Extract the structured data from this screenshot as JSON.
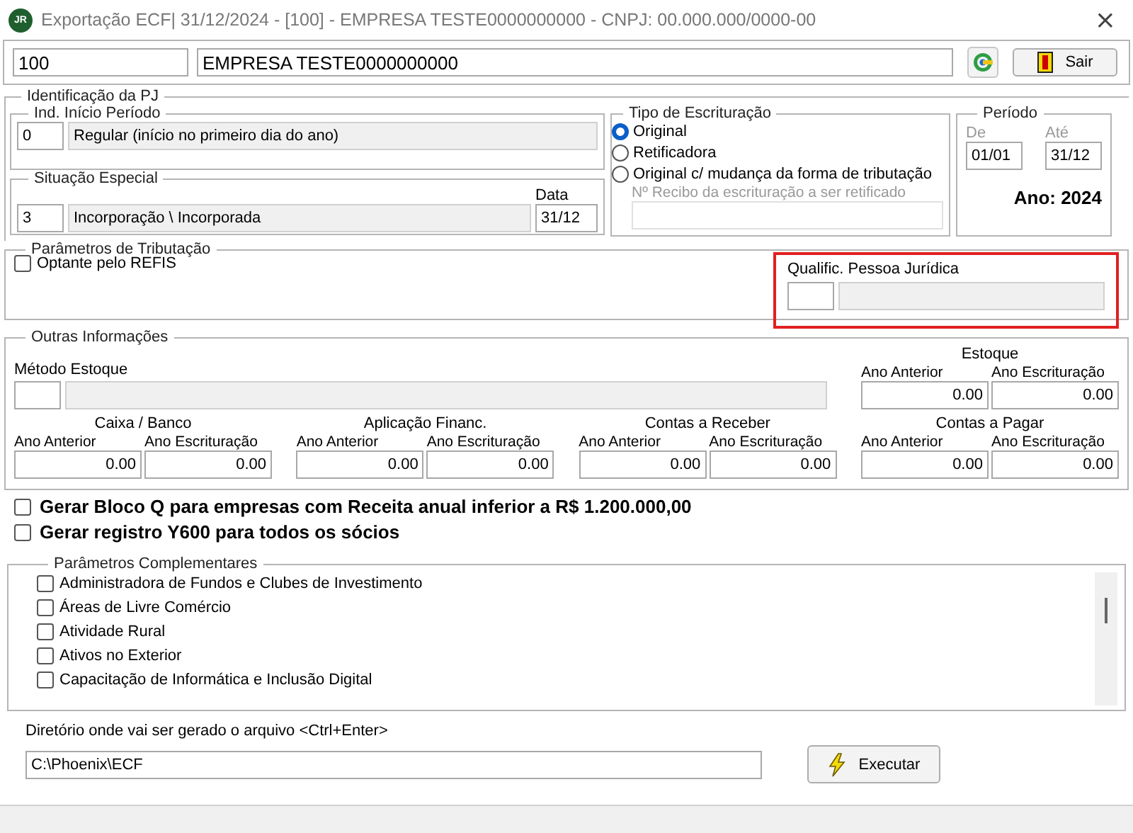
{
  "window": {
    "logo": "JR",
    "title": "Exportação ECF|  31/12/2024 - [100] - EMPRESA TESTE0000000000 - CNPJ: 00.000.000/0000-00",
    "close": "×"
  },
  "header": {
    "code": "100",
    "company": "EMPRESA TESTE0000000000",
    "exit_button": "Sair"
  },
  "identificacao": {
    "title": "Identificação da PJ",
    "inicio_periodo": {
      "title": "Ind. Início Período",
      "code": "0",
      "description": "Regular (início no primeiro dia do ano)"
    },
    "situacao_especial": {
      "title": "Situação Especial",
      "code": "3",
      "description": "Incorporação \\ Incorporada",
      "date_label": "Data",
      "date": "31/12"
    },
    "tipo_escrituracao": {
      "title": "Tipo de Escrituração",
      "options": [
        {
          "label": "Original",
          "selected": true
        },
        {
          "label": "Retificadora",
          "selected": false
        },
        {
          "label": "Original c/ mudança da forma de tributação",
          "selected": false
        }
      ],
      "recibo_label": "Nº Recibo da escrituração a ser retificado",
      "recibo_disabled": true
    },
    "periodo": {
      "title": "Período",
      "from_label": "De",
      "from": "01/01",
      "to_label": "Até",
      "to": "31/12",
      "year": "Ano: 2024"
    }
  },
  "tributacao": {
    "title": "Parâmetros de Tributação",
    "refis": {
      "label": "Optante pelo REFIS",
      "checked": false
    },
    "qualificacao_label": "Qualific. Pessoa Jurídica",
    "highlighted": true
  },
  "outras": {
    "title": "Outras Informações",
    "metodo_label": "Método Estoque",
    "estoque": {
      "title": "Estoque",
      "columns": [
        "Ano Anterior",
        "Ano Escrituração"
      ],
      "values": [
        "0.00",
        "0.00"
      ]
    },
    "groups": [
      {
        "title": "Caixa / Banco",
        "columns": [
          "Ano  Anterior",
          "Ano Escrituração"
        ],
        "values": [
          "0.00",
          "0.00"
        ]
      },
      {
        "title": "Aplicação Financ.",
        "columns": [
          "Ano  Anterior",
          "Ano Escrituração"
        ],
        "values": [
          "0.00",
          "0.00"
        ]
      },
      {
        "title": "Contas a Receber",
        "columns": [
          "Ano Anterior",
          "Ano Escrituração"
        ],
        "values": [
          "0.00",
          "0.00"
        ]
      },
      {
        "title": "Contas a Pagar",
        "columns": [
          "Ano Anterior",
          "Ano Escrituração"
        ],
        "values": [
          "0.00",
          "0.00"
        ]
      }
    ]
  },
  "options": [
    {
      "label": "Gerar Bloco Q para empresas com Receita anual inferior a R$ 1.200.000,00",
      "checked": false
    },
    {
      "label": "Gerar registro Y600 para todos os sócios",
      "checked": false
    }
  ],
  "complementares": {
    "title": "Parâmetros Complementares",
    "items": [
      {
        "label": "Administradora de Fundos e Clubes de Investimento",
        "checked": false
      },
      {
        "label": "Áreas de Livre Comércio",
        "checked": false
      },
      {
        "label": "Atividade Rural",
        "checked": false
      },
      {
        "label": "Ativos no Exterior",
        "checked": false
      },
      {
        "label": "Capacitação de Informática e Inclusão Digital",
        "checked": false
      }
    ]
  },
  "diretorio": {
    "label": "Diretório onde vai ser gerado o arquivo <Ctrl+Enter>",
    "value": "C:\\Phoenix\\ECF",
    "run_button": "Executar"
  }
}
